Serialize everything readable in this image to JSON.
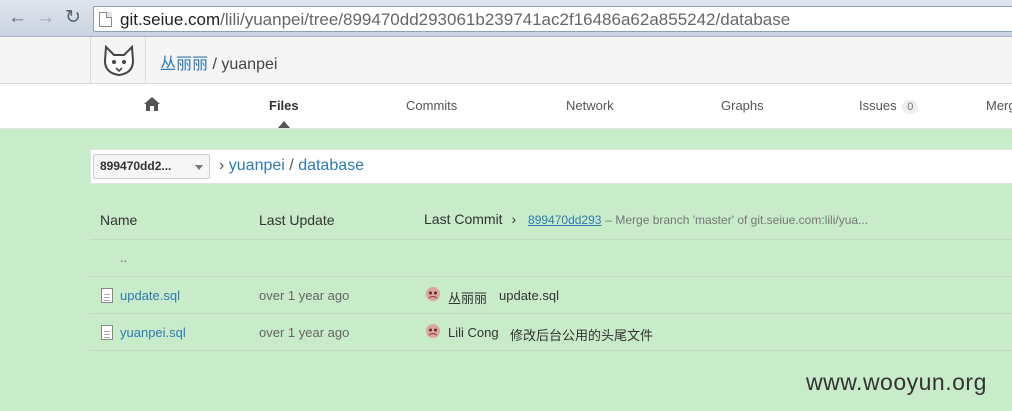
{
  "browser": {
    "url_domain": "git.seiue.com",
    "url_path": "/lili/yuanpei/tree/899470dd293061b239741ac2f16486a62a855242/database"
  },
  "header": {
    "owner": "丛丽丽",
    "separator": "/",
    "project": "yuanpei"
  },
  "tabs": [
    {
      "label": "Files",
      "active": true
    },
    {
      "label": "Commits"
    },
    {
      "label": "Network"
    },
    {
      "label": "Graphs"
    },
    {
      "label": "Issues",
      "badge": "0"
    },
    {
      "label": "Merg"
    }
  ],
  "tree": {
    "ref": "899470dd2...",
    "crumb_root": "yuanpei",
    "crumb_sep": "/",
    "crumb_dir": "database",
    "crumb_arrow": "›"
  },
  "table": {
    "col_name": "Name",
    "col_update": "Last Update",
    "col_commit": "Last Commit",
    "commit_arrow": "›",
    "last_commit_id": "899470dd293",
    "last_commit_msg": "– Merge branch 'master' of git.seiue.com:lili/yua...",
    "parent_dir": "..",
    "rows": [
      {
        "name": "update.sql",
        "updated": "over 1 year ago",
        "author": "丛丽丽",
        "message": "update.sql"
      },
      {
        "name": "yuanpei.sql",
        "updated": "over 1 year ago",
        "author": "Lili Cong",
        "message": "修改后台公用的头尾文件"
      }
    ]
  },
  "watermark": "www.wooyun.org",
  "colors": {
    "page_bg": "#c8ebc9",
    "link": "#2e7bb3"
  }
}
